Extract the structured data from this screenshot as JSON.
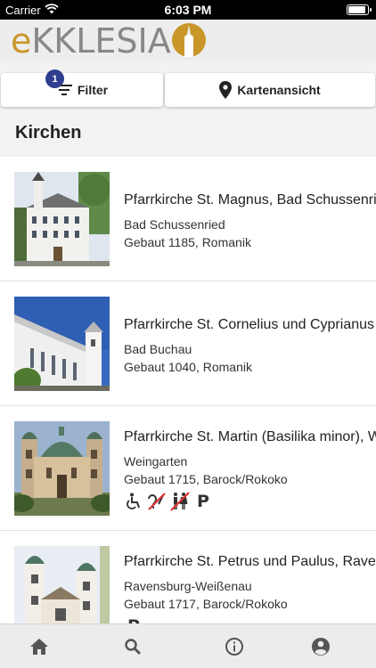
{
  "status_bar": {
    "carrier": "Carrier",
    "time": "6:03 PM"
  },
  "logo": {
    "prefix": "e",
    "name": "KKLESIA"
  },
  "actions": {
    "filter_label": "Filter",
    "filter_count": "1",
    "map_label": "Kartenansicht"
  },
  "section_title": "Kirchen",
  "churches": [
    {
      "title": "Pfarrkirche St. Magnus, Bad Schussenried",
      "place": "Bad Schussenried",
      "built": "Gebaut 1185, Romanik",
      "features": []
    },
    {
      "title": "Pfarrkirche St. Cornelius und Cyprianus",
      "place": "Bad Buchau",
      "built": "Gebaut 1040, Romanik",
      "features": []
    },
    {
      "title": "Pfarrkirche St. Martin (Basilika minor), Weingarten",
      "place": "Weingarten",
      "built": "Gebaut 1715, Barock/Rokoko",
      "features": [
        "wheelchair-icon",
        "no-hearing-icon",
        "no-toilet-icon",
        "parking-icon"
      ]
    },
    {
      "title": "Pfarrkirche St. Petrus und Paulus, Ravensburg",
      "place": "Ravensburg-Weißenau",
      "built": "Gebaut 1717, Barock/Rokoko",
      "features": [
        "parking-icon"
      ]
    }
  ],
  "feature_labels": {
    "parking": "P"
  },
  "tab_bar": [
    "home-icon",
    "search-icon",
    "info-icon",
    "account-icon"
  ],
  "colors": {
    "accent_gold": "#c9962a",
    "badge_blue": "#2f3d8f",
    "no_red": "#d33"
  }
}
